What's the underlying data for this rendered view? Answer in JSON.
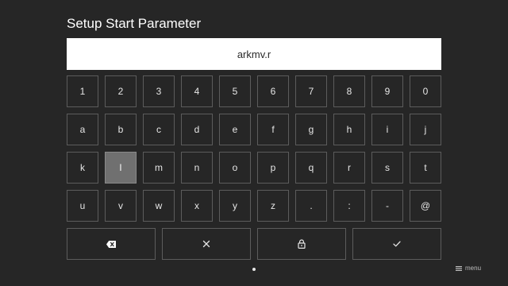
{
  "screen": {
    "title": "Setup Start Parameter",
    "input_value": "arkmv.r"
  },
  "keyboard": {
    "rows": [
      [
        "1",
        "2",
        "3",
        "4",
        "5",
        "6",
        "7",
        "8",
        "9",
        "0"
      ],
      [
        "a",
        "b",
        "c",
        "d",
        "e",
        "f",
        "g",
        "h",
        "i",
        "j"
      ],
      [
        "k",
        "l",
        "m",
        "n",
        "o",
        "p",
        "q",
        "r",
        "s",
        "t"
      ],
      [
        "u",
        "v",
        "w",
        "x",
        "y",
        "z",
        ".",
        ":",
        "-",
        "@"
      ]
    ],
    "focused_key": "l",
    "function_keys": [
      {
        "name": "backspace",
        "icon": "backspace-icon"
      },
      {
        "name": "clear",
        "icon": "close-icon"
      },
      {
        "name": "caps-lock",
        "icon": "lock-icon"
      },
      {
        "name": "confirm",
        "icon": "check-icon"
      }
    ]
  },
  "footer": {
    "menu_label": "menu",
    "menu_icon": "menu-icon",
    "page_indicator": {
      "pages": 1,
      "current": 1
    }
  },
  "colors": {
    "background": "#262626",
    "input_background": "#ffffff",
    "key_border": "#5c5c5c",
    "focused_key": "#707070"
  }
}
